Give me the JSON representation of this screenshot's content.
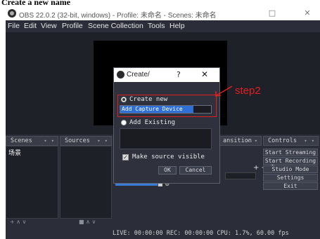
{
  "heading": "Create a new name",
  "window": {
    "title": "OBS 22.0.2 (32-bit, windows) - Profile: 未命名 - Scenes: 未命名",
    "maximize_glyph": "□",
    "close_glyph": "✕"
  },
  "menu": [
    "File",
    "Edit",
    "View",
    "Profile",
    "Scene Collection",
    "Tools",
    "Help"
  ],
  "docks": {
    "scenes": {
      "label": "Scenes",
      "items": [
        "场景"
      ]
    },
    "sources": {
      "label": "Sources"
    },
    "transitions": {
      "label": "ansition"
    },
    "controls": {
      "label": "Controls"
    }
  },
  "controls_buttons": [
    "Start Streaming",
    "Start Recording",
    "Studio Mode",
    "Settings",
    "Exit"
  ],
  "status": "LIVE: 00:00:00  REC: 00:00:00  CPU: 1.7%, 60.00 fps",
  "dialog": {
    "title": "Create/",
    "help_glyph": "?",
    "close_glyph": "✕",
    "create_new_label": "Create new",
    "name_value": "Add Capture Device",
    "add_existing_label": "Add Existing",
    "make_visible_label": "Make source visible",
    "ok_label": "OK",
    "cancel_label": "Cancel",
    "make_visible_checked": true,
    "create_new_selected": true
  },
  "annotation": {
    "step_label": "step2",
    "color": "#e02020"
  },
  "icons": {
    "app": "obs-logo-icon",
    "arrow": "red-arrow-icon",
    "add": "plus-icon",
    "gear": "gear-icon"
  },
  "misc": {
    "add_remove": "+ − ⚙",
    "dock_arrows": "▾ ▾",
    "footer_left": "+  ∧  ∨",
    "footer_sources": "■  ∧  ∨",
    "mixer_icons": "■ ⚙"
  }
}
